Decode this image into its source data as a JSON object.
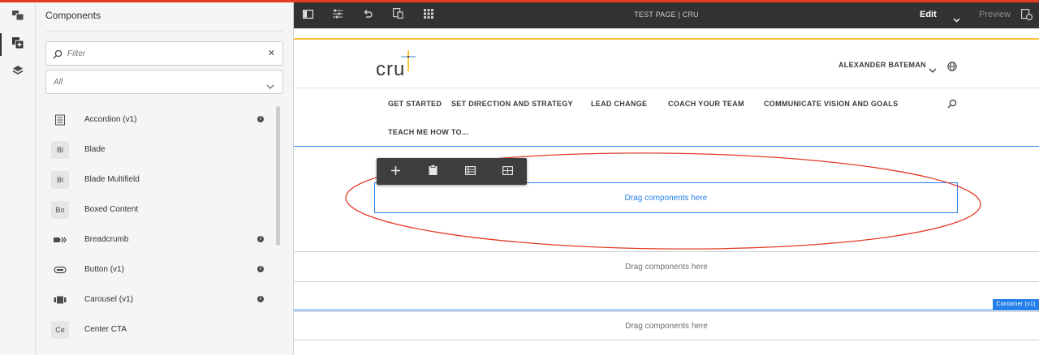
{
  "panel": {
    "title": "Components",
    "filter": {
      "placeholder": "Filter"
    },
    "group_select": {
      "value": "All"
    },
    "components": [
      {
        "label": "Accordion (v1)",
        "icon": "accordion-icon",
        "info": true
      },
      {
        "label": "Blade",
        "abbr": "Bl",
        "info": false
      },
      {
        "label": "Blade Multifield",
        "abbr": "Bl",
        "info": false
      },
      {
        "label": "Boxed Content",
        "abbr": "Bo",
        "info": false
      },
      {
        "label": "Breadcrumb",
        "icon": "breadcrumb-icon",
        "info": true
      },
      {
        "label": "Button (v1)",
        "icon": "button-icon",
        "info": true
      },
      {
        "label": "Carousel (v1)",
        "icon": "carousel-icon",
        "info": true
      },
      {
        "label": "Center CTA",
        "abbr": "Ce",
        "info": false
      }
    ]
  },
  "editor": {
    "doc_title": "TEST PAGE | CRU",
    "mode": "Edit",
    "preview": "Preview"
  },
  "site": {
    "logo": "cru",
    "user": "ALEXANDER BATEMAN",
    "nav": [
      "GET STARTED",
      "SET DIRECTION AND STRATEGY",
      "LEAD CHANGE",
      "COACH YOUR TEAM",
      "COMMUNICATE VISION AND GOALS",
      "TEACH ME HOW TO..."
    ]
  },
  "canvas": {
    "dropzone_1": "Drag components here",
    "dropzone_2": "Drag components here",
    "dropzone_3": "Drag components here",
    "container_label": "Container (v1)"
  },
  "colors": {
    "accent": "#2680eb",
    "annotation": "#e33b24",
    "brand_gold": "#f9c33a"
  }
}
